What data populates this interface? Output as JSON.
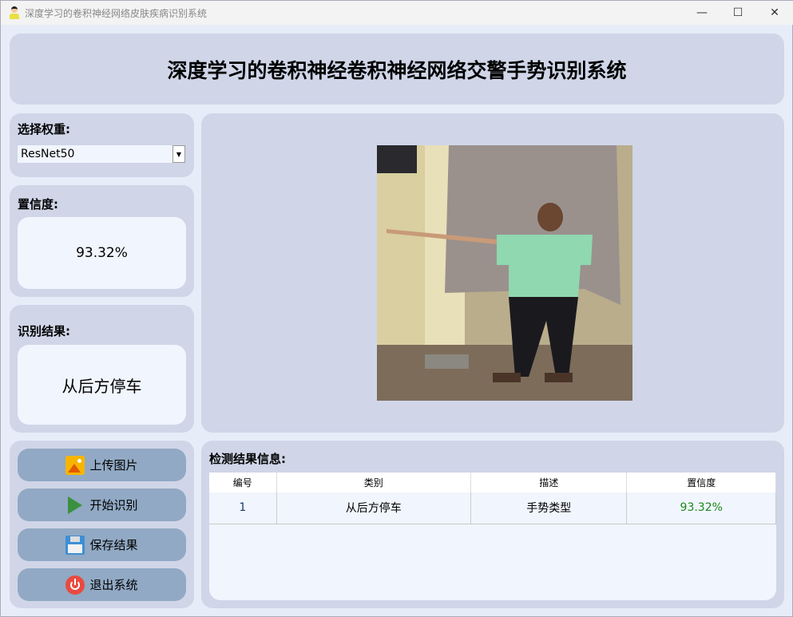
{
  "window": {
    "title": "深度学习的卷积神经网络皮肤疾病识别系统",
    "minimize": "—",
    "maximize": "☐",
    "close": "✕"
  },
  "header": {
    "title": "深度学习的卷积神经卷积神经网络交警手势识别系统"
  },
  "weights": {
    "label": "选择权重:",
    "selected": "ResNet50"
  },
  "confidence": {
    "label": "置信度:",
    "value": "93.32%"
  },
  "result": {
    "label": "识别结果:",
    "value": "从后方停车"
  },
  "buttons": {
    "upload": "上传图片",
    "start": "开始识别",
    "save": "保存结果",
    "exit": "退出系统"
  },
  "table": {
    "title": "检测结果信息:",
    "columns": [
      "编号",
      "类别",
      "描述",
      "置信度"
    ],
    "rows": [
      {
        "id": "1",
        "class": "从后方停车",
        "desc": "手势类型",
        "conf": "93.32%"
      }
    ]
  },
  "colors": {
    "confidence_text": "#1a8a1a",
    "panel": "#d0d6e8",
    "button": "#91a9c4"
  }
}
